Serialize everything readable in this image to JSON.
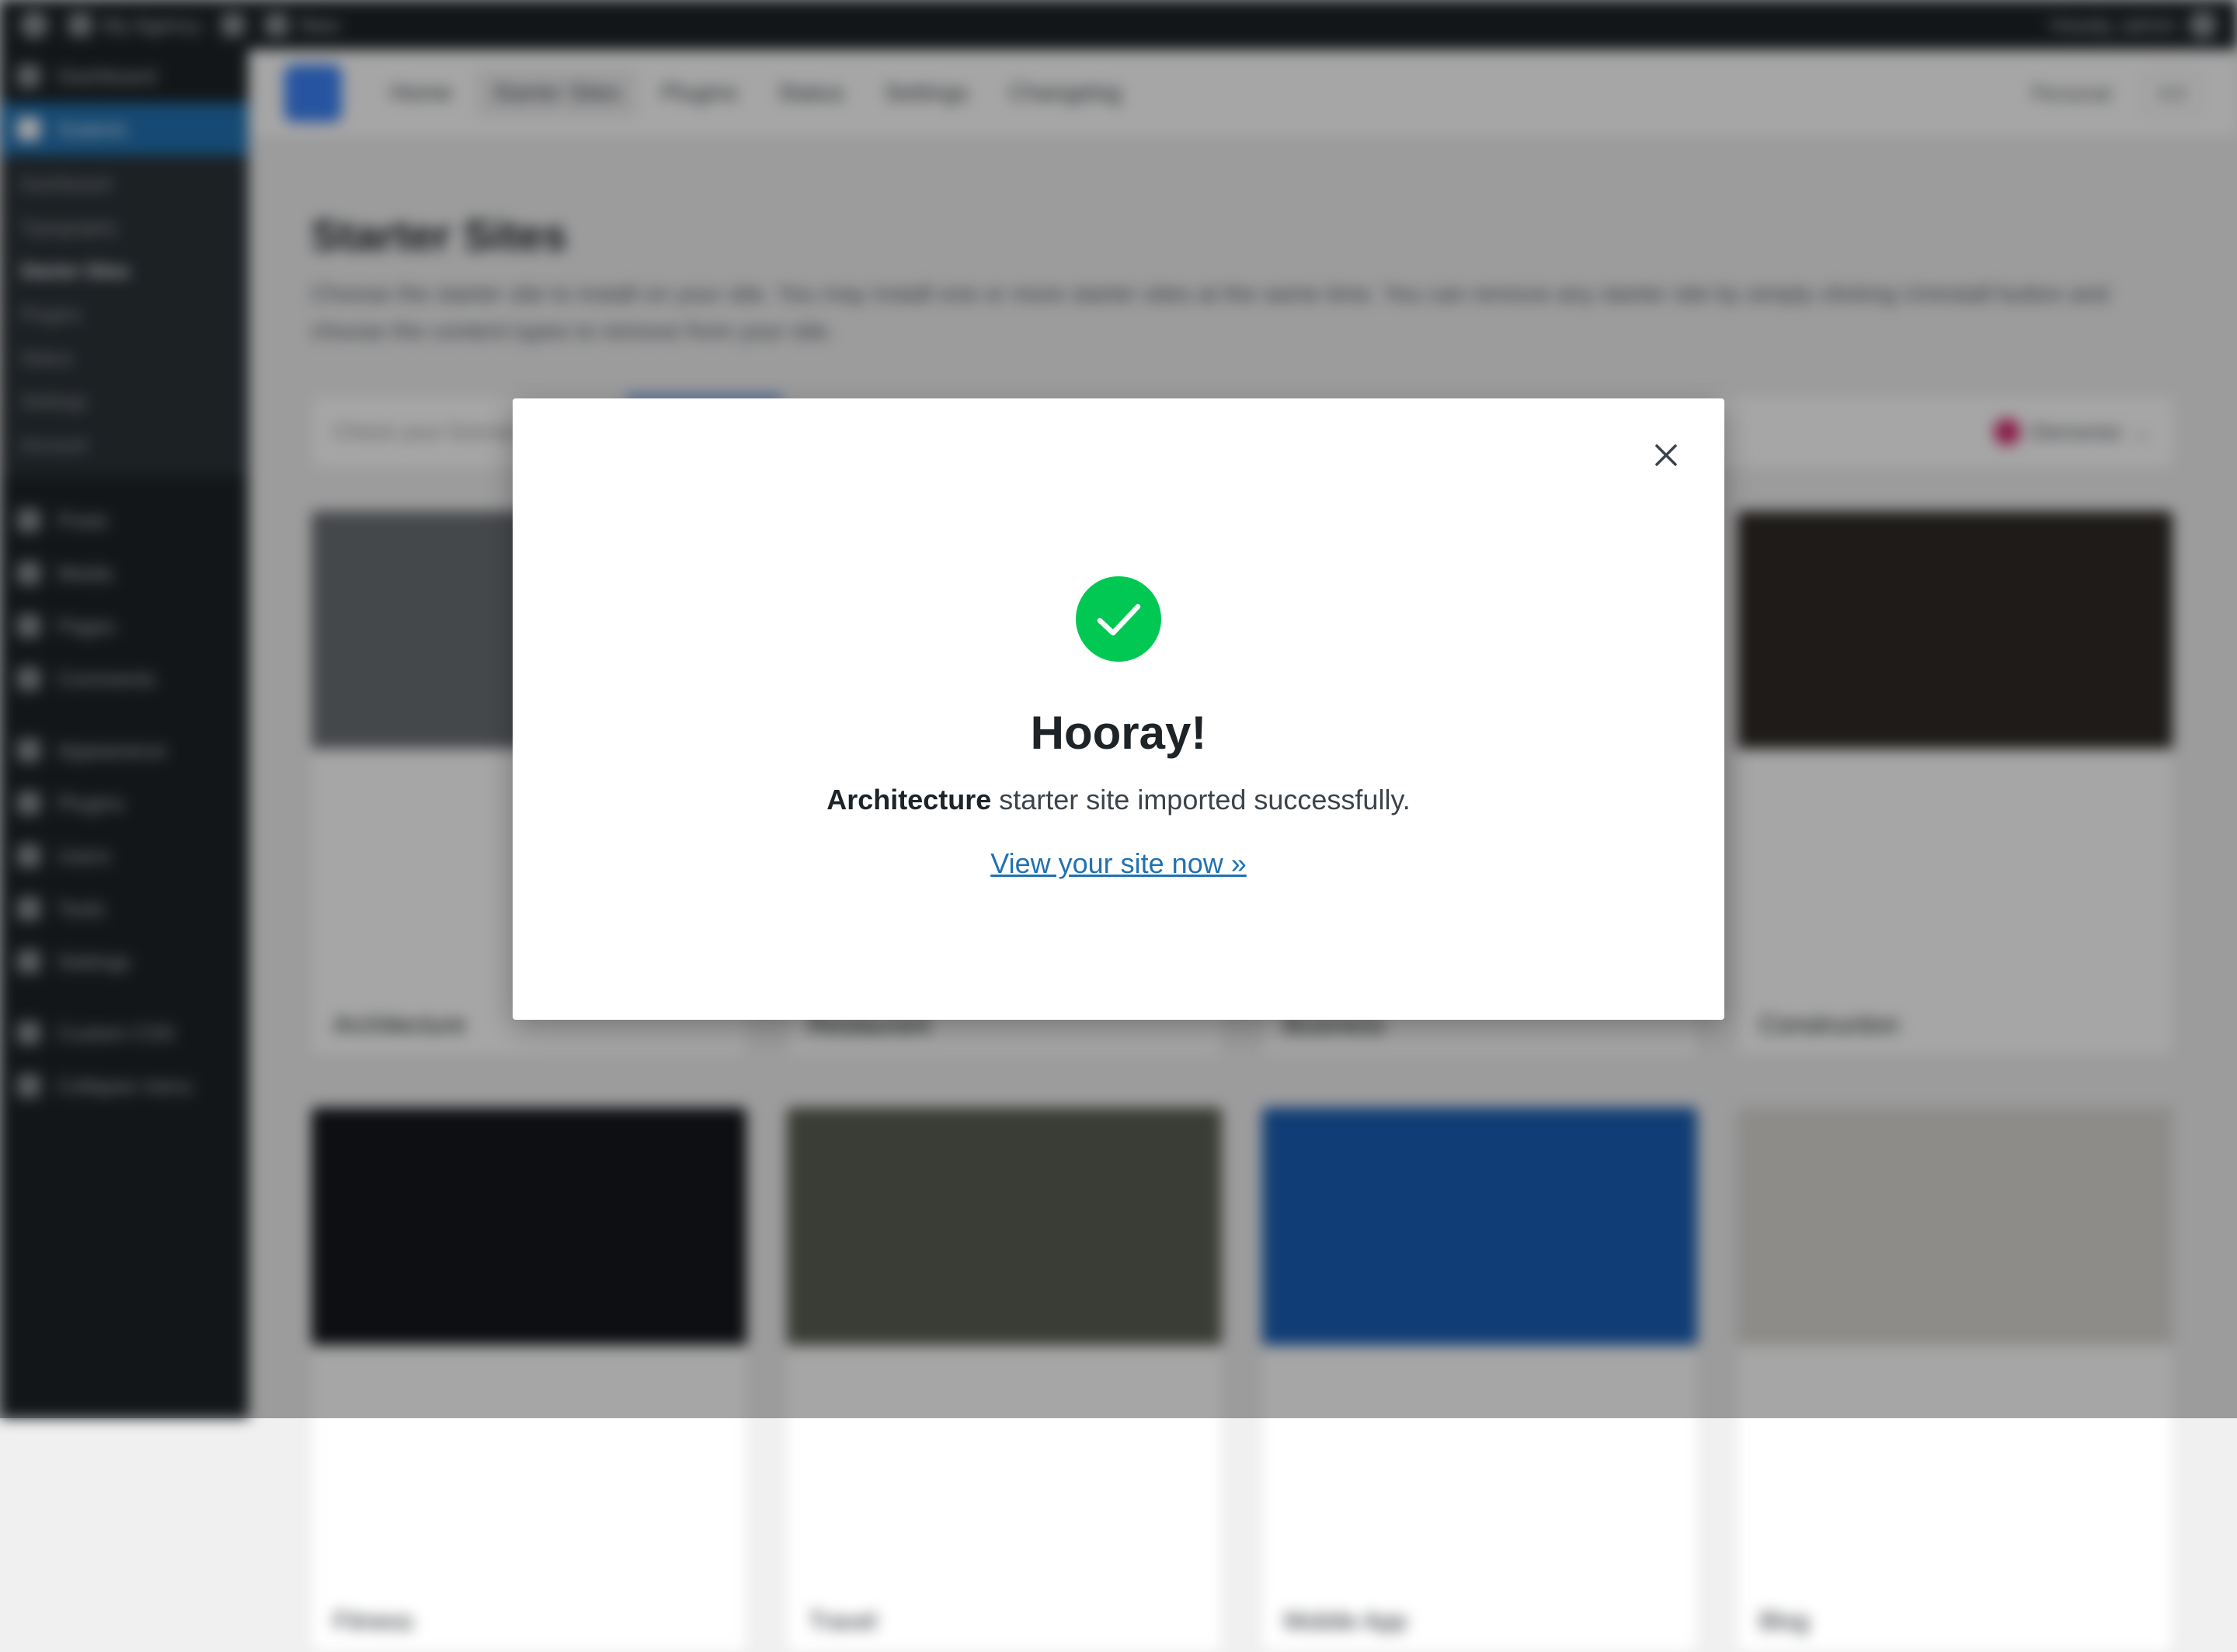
{
  "admin_bar": {
    "site_name": "My Agency",
    "new_label": "New",
    "greeting": "Howdy, admin"
  },
  "sidebar": {
    "items_top": [
      {
        "label": "Dashboard",
        "icon": "dashboard-icon"
      },
      {
        "label": "Gutenix",
        "icon": "gutenix-icon",
        "active": true
      }
    ],
    "submenu": [
      "Dashboard",
      "Typography",
      "Starter Sites",
      "Plugins",
      "Status",
      "Settings",
      "Account"
    ],
    "submenu_current": "Starter Sites",
    "items_main": [
      {
        "label": "Posts",
        "icon": "pin-icon"
      },
      {
        "label": "Media",
        "icon": "media-icon"
      },
      {
        "label": "Pages",
        "icon": "page-icon"
      },
      {
        "label": "Comments",
        "icon": "comment-icon"
      }
    ],
    "items_lower": [
      {
        "label": "Appearance",
        "icon": "brush-icon"
      },
      {
        "label": "Plugins",
        "icon": "plugin-icon"
      },
      {
        "label": "Users",
        "icon": "user-icon"
      },
      {
        "label": "Tools",
        "icon": "wrench-icon"
      },
      {
        "label": "Settings",
        "icon": "settings-icon"
      }
    ],
    "items_bottom": [
      {
        "label": "Custom CSS",
        "icon": "code-icon"
      },
      {
        "label": "Collapse menu",
        "icon": "collapse-icon"
      }
    ]
  },
  "top_nav": {
    "tabs": [
      "Home",
      "Starter Sites",
      "Plugins",
      "Status",
      "Settings",
      "Changelog"
    ],
    "current_tab": "Starter Sites",
    "right_link": "Personal",
    "right_badge": "4.0"
  },
  "page": {
    "title": "Starter Sites",
    "description": "Choose the starter site to install on your site. You may install one or more starter sites at the same time. You can remove any starter site by simply clicking Uninstall button and choose the content types to remove from your site.",
    "search_placeholder": "Check your license",
    "builder_label": "Elementor"
  },
  "cards": [
    "Architecture",
    "Restaurant",
    "Business",
    "Construction",
    "Fitness",
    "Travel",
    "Mobile App",
    "Blog"
  ],
  "modal": {
    "title": "Hooray!",
    "site_name": "Architecture",
    "message_suffix": " starter site imported successfully.",
    "link_text": "View your site now »",
    "success_color": "#00c853",
    "link_color": "#2271b1"
  }
}
